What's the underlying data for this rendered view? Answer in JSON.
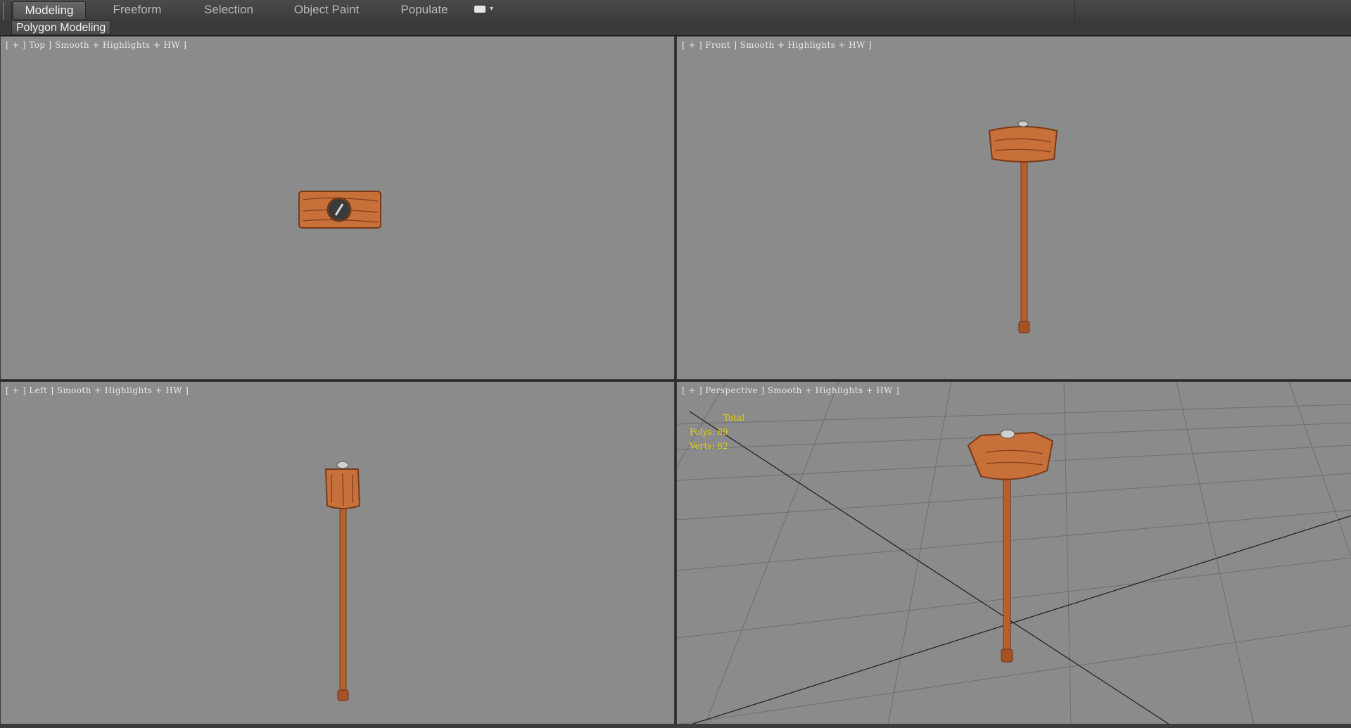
{
  "ribbon": {
    "tabs": [
      {
        "label": "Modeling",
        "active": true
      },
      {
        "label": "Freeform",
        "active": false
      },
      {
        "label": "Selection",
        "active": false
      },
      {
        "label": "Object Paint",
        "active": false
      },
      {
        "label": "Populate",
        "active": false
      }
    ],
    "extra_icon": "ribbon-options-icon"
  },
  "subribbon": {
    "panel_label": "Polygon Modeling"
  },
  "viewports": {
    "top": {
      "label": "[ + ] Top ] Smooth + Highlights + HW ]"
    },
    "front": {
      "label": "[ + ] Front ] Smooth + Highlights + HW ]"
    },
    "left": {
      "label": "[ + ] Left ] Smooth + Highlights + HW ]"
    },
    "perspective": {
      "label": "[ + ] Perspective ] Smooth + Highlights + HW ]",
      "stats": {
        "total_label": "Total",
        "polys": "Polys: 89",
        "verts": "Verts: 82"
      }
    }
  },
  "colors": {
    "viewport_bg": "#8b8b8b",
    "wood": "#c8703a",
    "handle": "#b85f2e",
    "stats_text": "#e6d20a"
  }
}
